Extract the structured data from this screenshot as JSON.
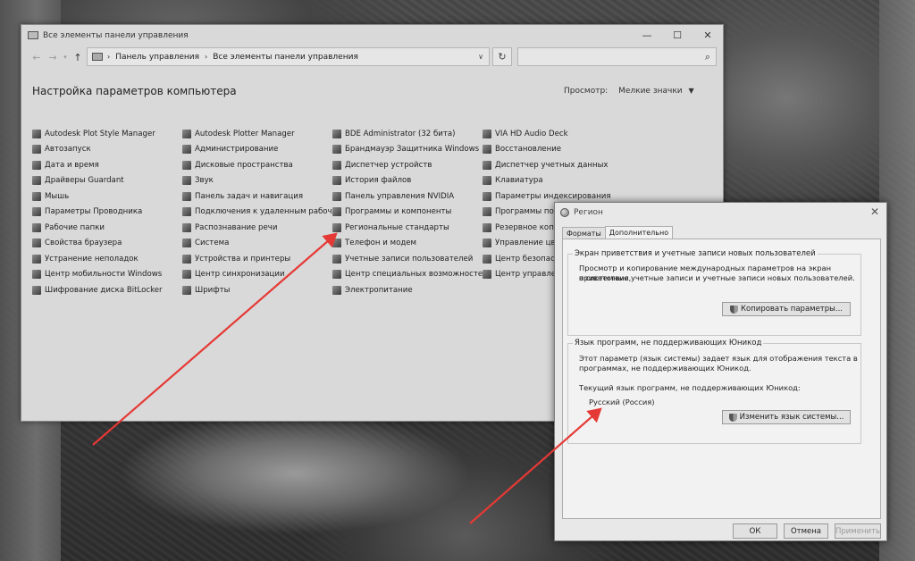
{
  "control_panel": {
    "title": "Все элементы панели управления",
    "breadcrumb": [
      "Панель управления",
      "Все элементы панели управления"
    ],
    "breadcrumb_sep": "›",
    "heading": "Настройка параметров компьютера",
    "view_by_label": "Просмотр:",
    "view_by_value": "Мелкие значки",
    "columns": [
      [
        "Autodesk Plot Style Manager",
        "Автозапуск",
        "Дата и время",
        "Драйверы Guardant",
        "Мышь",
        "Параметры Проводника",
        "Рабочие папки",
        "Свойства браузера",
        "Устранение неполадок",
        "Центр мобильности Windows",
        "Шифрование диска BitLocker"
      ],
      [
        "Autodesk Plotter Manager",
        "Администрирование",
        "Дисковые пространства",
        "Звук",
        "Панель задач и навигация",
        "Подключения к удаленным рабоч...",
        "Распознавание речи",
        "Система",
        "Устройства и принтеры",
        "Центр синхронизации",
        "Шрифты"
      ],
      [
        "BDE Administrator (32 бита)",
        "Брандмауэр Защитника Windows",
        "Диспетчер устройств",
        "История файлов",
        "Панель управления NVIDIA",
        "Программы и компоненты",
        "Региональные стандарты",
        "Телефон и модем",
        "Учетные записи пользователей",
        "Центр специальных возможностей",
        "Электропитание"
      ],
      [
        "VIA HD Audio Deck",
        "Восстановление",
        "Диспетчер учетных данных",
        "Клавиатура",
        "Параметры индексирования",
        "Программы по",
        "Резервное копир",
        "Управление цвете",
        "Центр безопасно",
        "Центр управлени"
      ]
    ]
  },
  "region_dialog": {
    "title": "Регион",
    "tabs": [
      "Форматы",
      "Дополнительно"
    ],
    "active_tab": "Дополнительно",
    "group1": {
      "legend": "Экран приветствия и учетные записи новых пользователей",
      "text_line1": "Просмотр и копирование международных параметров на экран приветствия,",
      "text_line2": "в системные учетные записи и учетные записи новых пользователей.",
      "button": "Копировать параметры..."
    },
    "group2": {
      "legend": "Язык программ, не поддерживающих Юникод",
      "text_line1": "Этот параметр (язык системы) задает язык для отображения текста в",
      "text_line2": "программах, не поддерживающих Юникод.",
      "current_label": "Текущий язык программ, не поддерживающих Юникод:",
      "current_value": "Русский (Россия)",
      "button": "Изменить язык системы..."
    },
    "ok": "ОК",
    "cancel": "Отмена",
    "apply": "Применить"
  },
  "annotation_color": "#e53935"
}
